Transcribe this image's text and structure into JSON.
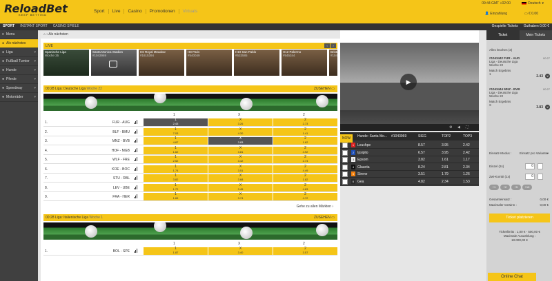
{
  "brand": {
    "logo": "ReloadBet",
    "tagline": "KEEP BETTING"
  },
  "topnav": [
    "Sport",
    "Live",
    "Casino",
    "Promotionen",
    "Virtuals"
  ],
  "header": {
    "time": "09:44 GMT +02:00",
    "lang": "Deutsch",
    "login": "Einzahlung",
    "balance": "€ 0.00"
  },
  "subbar": {
    "left": [
      "SPORT",
      "INSTANT SPORT",
      "CASINO SPIELE"
    ],
    "right": [
      "Gespielte Tickets",
      "Guthaben 0,00 €"
    ]
  },
  "sidebar": [
    "Menu",
    "Als nächstes",
    "Liga",
    "Fußball Turnier",
    "Hunde",
    "Pferde",
    "Speedway",
    "Motorräder"
  ],
  "breadcrumb": "Als nächsten",
  "live": {
    "label": "LIVE",
    "thumbs": [
      {
        "t1": "Spanische Liga",
        "t2": "Woche 35",
        "kind": "soccer"
      },
      {
        "t1": "Santa Monica Stadion",
        "t2": "#1043969",
        "kind": "stad"
      },
      {
        "t1": "H6 Royal Meadow",
        "t2": "#1615394",
        "kind": "dog"
      },
      {
        "t1": "H8 Paris",
        "t2": "#540049",
        "kind": "dog"
      },
      {
        "t1": "H10 San Pablo",
        "t2": "#533585",
        "kind": "dog"
      },
      {
        "t1": "H12 Palermo",
        "t2": "#545344",
        "kind": "dog"
      },
      {
        "t1": "Bristo",
        "t2": "#1043",
        "kind": "dog"
      }
    ]
  },
  "leagues": [
    {
      "time": "00:28",
      "title": "Liga: Deutsche Liga",
      "week": "Woche 22",
      "zusehen": "ZUSEHEN",
      "cols": [
        "1",
        "X",
        "2"
      ],
      "rows": [
        {
          "n": "1.",
          "teams": "FUR - AUG",
          "o": [
            "2.43",
            "3.26",
            "2.73"
          ],
          "sel": 0
        },
        {
          "n": "2.",
          "teams": "BLF - BMU",
          "o": [
            "7.03",
            "4.30",
            "1.41"
          ]
        },
        {
          "n": "3.",
          "teams": "MNZ - BVB",
          "o": [
            "4.87",
            "3.83",
            "1.62"
          ],
          "sel": 1
        },
        {
          "n": "4.",
          "teams": "HOF - MGB",
          "o": [
            "1.62",
            "3.81",
            "4.92"
          ]
        },
        {
          "n": "5.",
          "teams": "WLF - FRE",
          "o": [
            "2.52",
            "3.42",
            "2.74"
          ]
        },
        {
          "n": "6.",
          "teams": "KOE - BOC",
          "o": [
            "1.74",
            "3.51",
            "4.49"
          ]
        },
        {
          "n": "7.",
          "teams": "STU - RBL",
          "o": [
            "3.82",
            "3.68",
            "1.82"
          ]
        },
        {
          "n": "8.",
          "teams": "LEV - UBE",
          "o": [
            "1.72",
            "3.45",
            "4.83"
          ]
        },
        {
          "n": "9.",
          "teams": "FRA - HER",
          "o": [
            "1.65",
            "3.74",
            "4.72"
          ]
        }
      ],
      "more": "Gehe zu allen Märkten"
    },
    {
      "time": "00:28",
      "title": "Liga: Italienische Liga",
      "week": "Woche 1",
      "zusehen": "ZUSEHEN",
      "cols": [
        "1",
        "X",
        "2"
      ],
      "rows": [
        {
          "n": "1.",
          "teams": "BOL - SPE",
          "o": [
            "1.87",
            "3.40",
            "3.57"
          ]
        }
      ]
    }
  ],
  "race": {
    "now": "NOW",
    "title": "Hunde: Santa Mo...",
    "id": "#1043969",
    "cols": [
      "SIEG",
      "TOP2",
      "TOP3"
    ],
    "runners": [
      {
        "n": "1",
        "name": "Leuchpe",
        "c": "#d22",
        "o": [
          "8.57",
          "3.95",
          "2.42"
        ]
      },
      {
        "n": "2",
        "name": "Ipsiplio",
        "c": "#1f4fb5",
        "o": [
          "6.57",
          "3.95",
          "2.42"
        ]
      },
      {
        "n": "3",
        "name": "Epsom",
        "c": "#eee",
        "o": [
          "3.82",
          "1.61",
          "1.17"
        ]
      },
      {
        "n": "4",
        "name": "Glauota",
        "c": "#111",
        "o": [
          "8.24",
          "2.81",
          "2.34"
        ]
      },
      {
        "n": "5",
        "name": "Sirene",
        "c": "#f5810c",
        "o": [
          "3.51",
          "1.79",
          "1.26"
        ]
      },
      {
        "n": "6",
        "name": "Gea",
        "c": "#2b2b2b",
        "o": [
          "4.82",
          "2.34",
          "1.53"
        ]
      }
    ]
  },
  "betslip": {
    "tabs": [
      "Ticket",
      "Mein Tickets"
    ],
    "clear": "Alles löschen (2)",
    "bets": [
      {
        "id": "#1043442",
        "match": "FUR - AUG",
        "lg": "Liga - Deutsche Liga",
        "wk": "Woche 22",
        "tip": "Match Ergebnis",
        "pick": "1",
        "odd": "2.43",
        "t": "00:27"
      },
      {
        "id": "#1043444",
        "match": "MNZ - BVB",
        "lg": "Liga - Deutsche Liga",
        "wk": "Woche 22",
        "tip": "Match Ergebnis",
        "pick": "X",
        "odd": "3.83",
        "t": "00:27"
      }
    ],
    "modus": "Einsatz-Modus :",
    "modus_val": "Einsatz pro Variante",
    "single": "Einzel (2x)",
    "kombi": "Zwi-Kombi (1x)",
    "inputs": [
      "0",
      "0"
    ],
    "chips": [
      "+1",
      "+2",
      "+5",
      "+10"
    ],
    "total_label": "Gesamteinsatz :",
    "total": "0,00 €",
    "win_label": "Maximaler Gewinn :",
    "win": "0,00 €",
    "place": "Ticket platzieren",
    "limits": [
      "Ticketlimits : 1,00 € - 500,00 €",
      "Maximale Auszahlung :",
      "10.000,00 €"
    ]
  },
  "chat": "Online Chat"
}
